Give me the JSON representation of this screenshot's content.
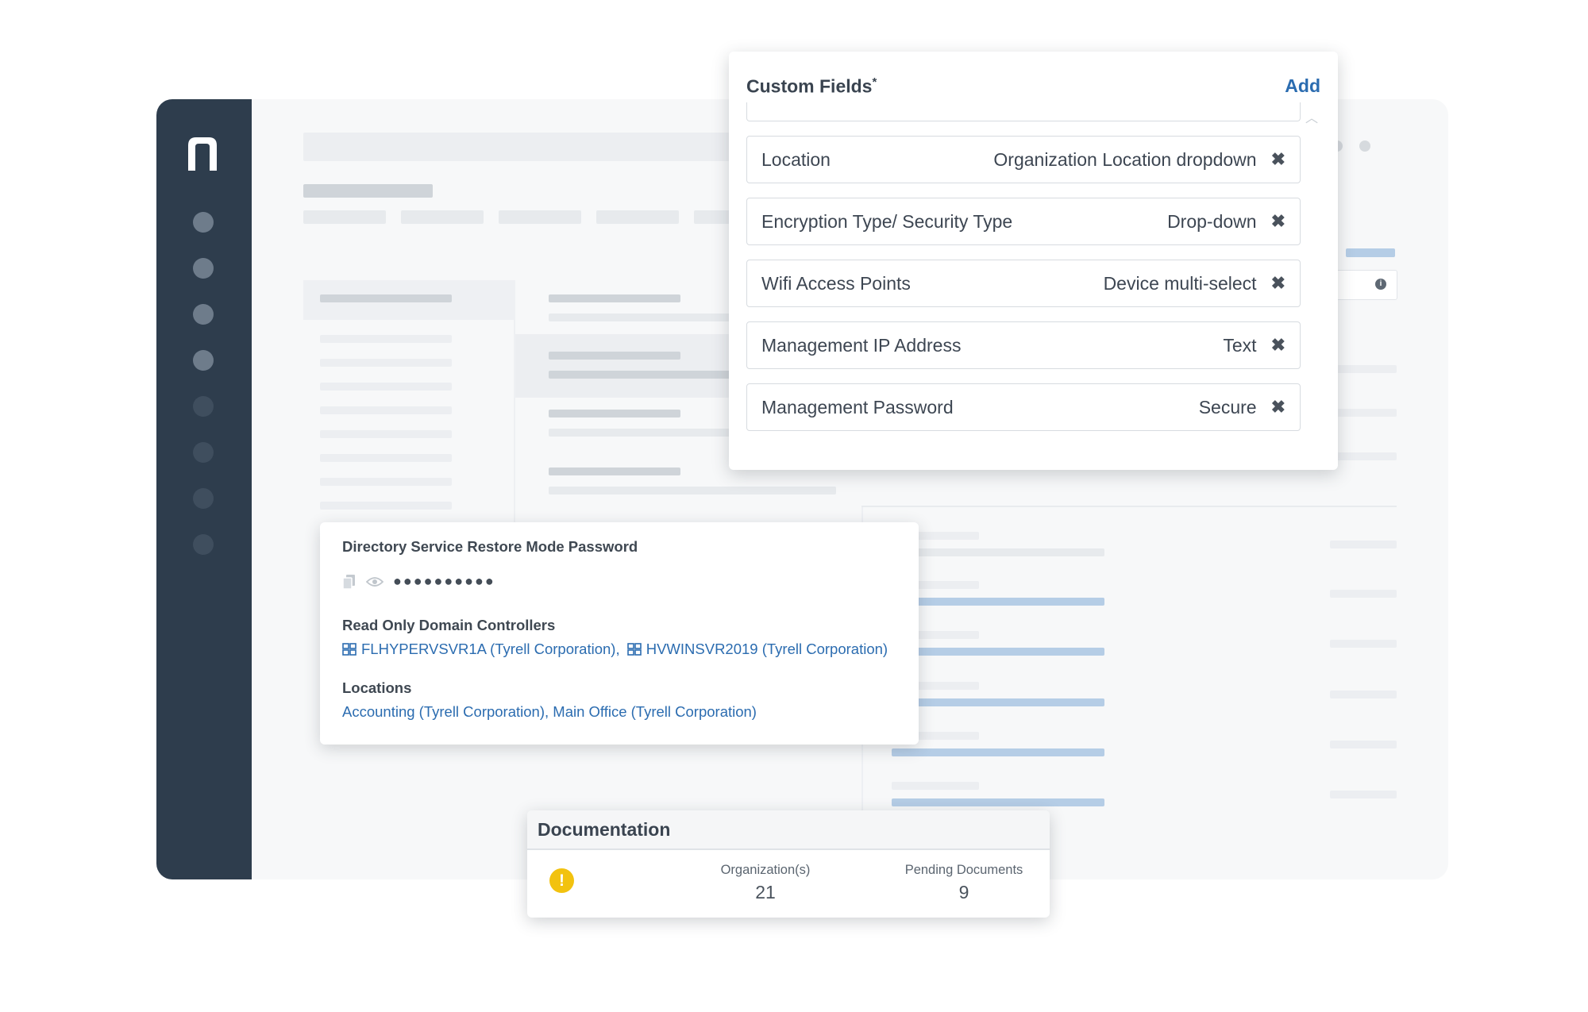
{
  "custom_fields": {
    "title": "Custom Fields",
    "required_mark": "*",
    "add_label": "Add",
    "rows": [
      {
        "name": "Location",
        "type": "Organization Location dropdown"
      },
      {
        "name": "Encryption Type/ Security Type",
        "type": "Drop-down"
      },
      {
        "name": "Wifi Access Points",
        "type": "Device multi-select"
      },
      {
        "name": "Management IP Address",
        "type": "Text"
      },
      {
        "name": "Management Password",
        "type": "Secure"
      }
    ],
    "remove_glyph": "✖"
  },
  "directory": {
    "password_label": "Directory Service Restore Mode Password",
    "password_mask": "●●●●●●●●●●",
    "rodc_label": "Read Only Domain Controllers",
    "rodc_items": [
      "FLHYPERVSVR1A (Tyrell Corporation),",
      "HVWINSVR2019 (Tyrell Corporation)"
    ],
    "locations_label": "Locations",
    "locations_value": "Accounting (Tyrell Corporation), Main Office (Tyrell Corporation)"
  },
  "documentation": {
    "title": "Documentation",
    "warning_glyph": "!",
    "org_label": "Organization(s)",
    "org_value": "21",
    "pending_label": "Pending Documents",
    "pending_value": "9"
  },
  "icons": {
    "logo": "n-logo-icon",
    "copy": "copy-icon",
    "reveal": "eye-icon",
    "server": "server-icon",
    "warning": "warning-icon",
    "remove": "close-icon"
  },
  "colors": {
    "sidebar": "#2e3d4d",
    "link": "#2b6cb0",
    "warning": "#f2c20f"
  }
}
